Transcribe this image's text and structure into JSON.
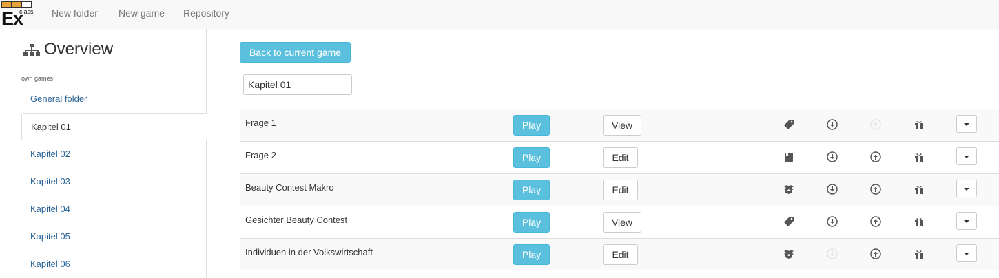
{
  "logo": {
    "text": "Ex",
    "sub": "class"
  },
  "nav": {
    "links": [
      "New folder",
      "New game",
      "Repository"
    ]
  },
  "sidebar": {
    "title": "Overview",
    "section_label": "own games",
    "folders": [
      {
        "label": "General folder",
        "active": false
      },
      {
        "label": "Kapitel 01",
        "active": true
      },
      {
        "label": "Kapitel 02",
        "active": false
      },
      {
        "label": "Kapitel 03",
        "active": false
      },
      {
        "label": "Kapitel 04",
        "active": false
      },
      {
        "label": "Kapitel 05",
        "active": false
      },
      {
        "label": "Kapitel 06",
        "active": false
      }
    ]
  },
  "main": {
    "back_button": "Back to current game",
    "folder_name": "Kapitel 01",
    "games": [
      {
        "name": "Frage 1",
        "play": "Play",
        "action": "View",
        "type_icon": "tag-icon",
        "download_active": true,
        "upload_active": false
      },
      {
        "name": "Frage 2",
        "play": "Play",
        "action": "Edit",
        "type_icon": "book-icon",
        "download_active": true,
        "upload_active": true
      },
      {
        "name": "Beauty Contest Makro",
        "play": "Play",
        "action": "Edit",
        "type_icon": "box-open-icon",
        "download_active": true,
        "upload_active": true
      },
      {
        "name": "Gesichter Beauty Contest",
        "play": "Play",
        "action": "View",
        "type_icon": "tag-icon",
        "download_active": true,
        "upload_active": true
      },
      {
        "name": "Individuen in der Volkswirtschaft",
        "play": "Play",
        "action": "Edit",
        "type_icon": "box-open-icon",
        "download_active": false,
        "upload_active": true
      }
    ]
  }
}
